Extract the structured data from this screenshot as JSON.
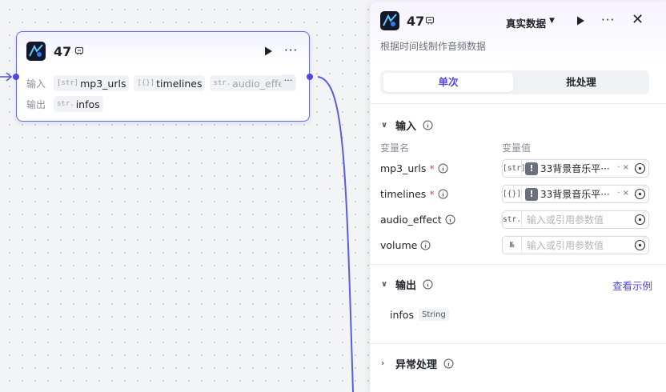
{
  "node": {
    "title": "47",
    "input_label": "输入",
    "output_label": "输出",
    "inputs": [
      {
        "type": "[str]",
        "name": "mp3_urls"
      },
      {
        "type": "[{}]",
        "name": "timelines"
      },
      {
        "type": "str.",
        "name": "audio_effect"
      }
    ],
    "outputs": [
      {
        "type": "str.",
        "name": "infos"
      }
    ],
    "more_params": "···"
  },
  "panel": {
    "title": "47",
    "mode": "真实数据",
    "description": "根据时间线制作音频数据",
    "tabs": [
      {
        "label": "单次",
        "active": true
      },
      {
        "label": "批处理",
        "active": false
      }
    ],
    "input_section": {
      "title": "输入",
      "col_name": "变量名",
      "col_value": "变量值",
      "params": [
        {
          "name": "mp3_urls",
          "required": true,
          "type": "[str]",
          "ref": "33背景音乐平···",
          "placeholder": ""
        },
        {
          "name": "timelines",
          "required": true,
          "type": "[{}]",
          "ref": "33背景音乐平···",
          "placeholder": ""
        },
        {
          "name": "audio_effect",
          "required": false,
          "type": "str.",
          "ref": "",
          "placeholder": "输入或引用参数值"
        },
        {
          "name": "volume",
          "required": false,
          "type": "№",
          "ref": "",
          "placeholder": "输入或引用参数值"
        }
      ]
    },
    "output_section": {
      "title": "输出",
      "demo_link": "查看示例",
      "outputs": [
        {
          "name": "infos",
          "type": "String"
        }
      ]
    },
    "error_section": {
      "title": "异常处理"
    }
  },
  "colors": {
    "accent": "#4f46e5",
    "node_border": "#6366f1",
    "edge": "#5b5be6"
  }
}
